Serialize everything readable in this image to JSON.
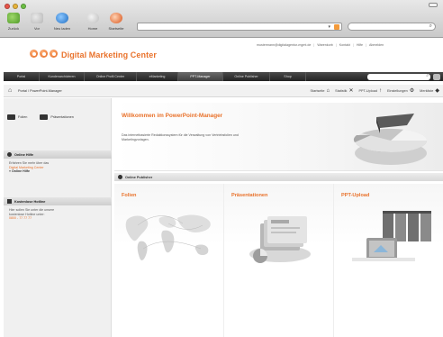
{
  "browser": {
    "nav_buttons": [
      {
        "label": "Zurück",
        "icon": "back-arrow-icon"
      },
      {
        "label": "Vor",
        "icon": "forward-arrow-icon"
      },
      {
        "label": "Neu laden",
        "icon": "reload-icon"
      },
      {
        "label": "Home",
        "icon": "home-icon"
      },
      {
        "label": "Startseite",
        "icon": "start-page-icon"
      }
    ]
  },
  "site": {
    "title": "Digital Marketing Center",
    "header_links": [
      "mustermann@digitalagentur-mgmt.de",
      "Warenkorb",
      "Kontakt",
      "Hilfe",
      "Abmelden"
    ]
  },
  "mainnav": {
    "tabs": [
      "Portal",
      "Kundenarchivieren",
      "Online Profil Center",
      "eMarketing",
      "PPT-Manager",
      "Online Publisher",
      "Shop"
    ]
  },
  "breadcrumb": {
    "text": "Portal / PowerPoint-Manager"
  },
  "toolbar": {
    "items": [
      {
        "label": "Startseite",
        "icon": "home-icon"
      },
      {
        "label": "Statistik",
        "icon": "tools-icon"
      },
      {
        "label": "PPT-Upload",
        "icon": "upload-icon"
      },
      {
        "label": "Einstellungen",
        "icon": "settings-icon"
      },
      {
        "label": "Merkliste",
        "icon": "bookmark-icon"
      }
    ]
  },
  "sidebar": {
    "top_items": [
      {
        "label": "Folien",
        "icon": "folder-icon"
      },
      {
        "label": "Präsentationen",
        "icon": "folder-icon"
      }
    ],
    "help_box": {
      "title": "Online Hilfe",
      "line1": "Erfahren Sie mehr über das",
      "line2": "Digital Marketing Center",
      "link": "Online Hilfe"
    },
    "hotline_box": {
      "title": "Kostenlose Hotline",
      "line1": "Hier sollen Sie unter die unsere",
      "line2": "kostenlose Hotline unter:",
      "phone": "0800 - 77 77 77"
    }
  },
  "content": {
    "hero_title": "Willkommen im PowerPoint-Manager",
    "hero_text": "Das internetbasierte Redaktionssystem für die Verwaltung von Vertriebsfolien und Marketingvorlagen.",
    "section_title": "Online Publisher",
    "cards": [
      {
        "title": "Folien"
      },
      {
        "title": "Präsentationen"
      },
      {
        "title": "PPT-Upload"
      }
    ]
  }
}
